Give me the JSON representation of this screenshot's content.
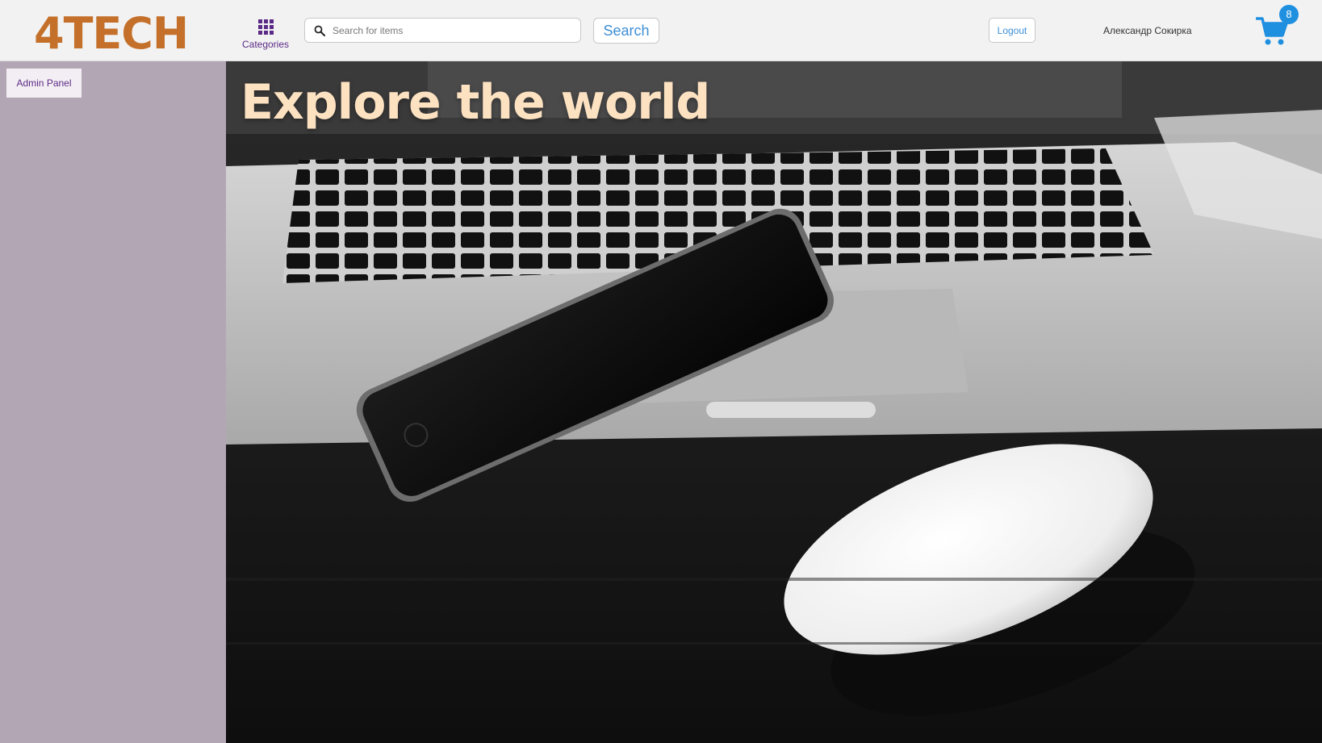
{
  "colors": {
    "brand": "#c4702a",
    "accent_purple": "#5b2a86",
    "search_blue": "#3d8fd6",
    "cart_blue": "#1f8fe0",
    "sidebar": "#b2a6b4",
    "hero_title": "#fde2c2"
  },
  "header": {
    "logo": "4TECH",
    "categories_label": "Categories",
    "categories_icon": "grid-icon",
    "search": {
      "placeholder": "Search for items",
      "value": "",
      "icon": "search-icon",
      "button_label": "Search"
    },
    "logout_label": "Logout",
    "user_name": "Александр Сокирка",
    "cart": {
      "icon": "cart-icon",
      "count": "8"
    }
  },
  "sidebar": {
    "admin_panel_label": "Admin Panel"
  },
  "hero": {
    "title": "Explore the world",
    "image": "photo of laptop, smartphone and mouse on dark desk"
  }
}
